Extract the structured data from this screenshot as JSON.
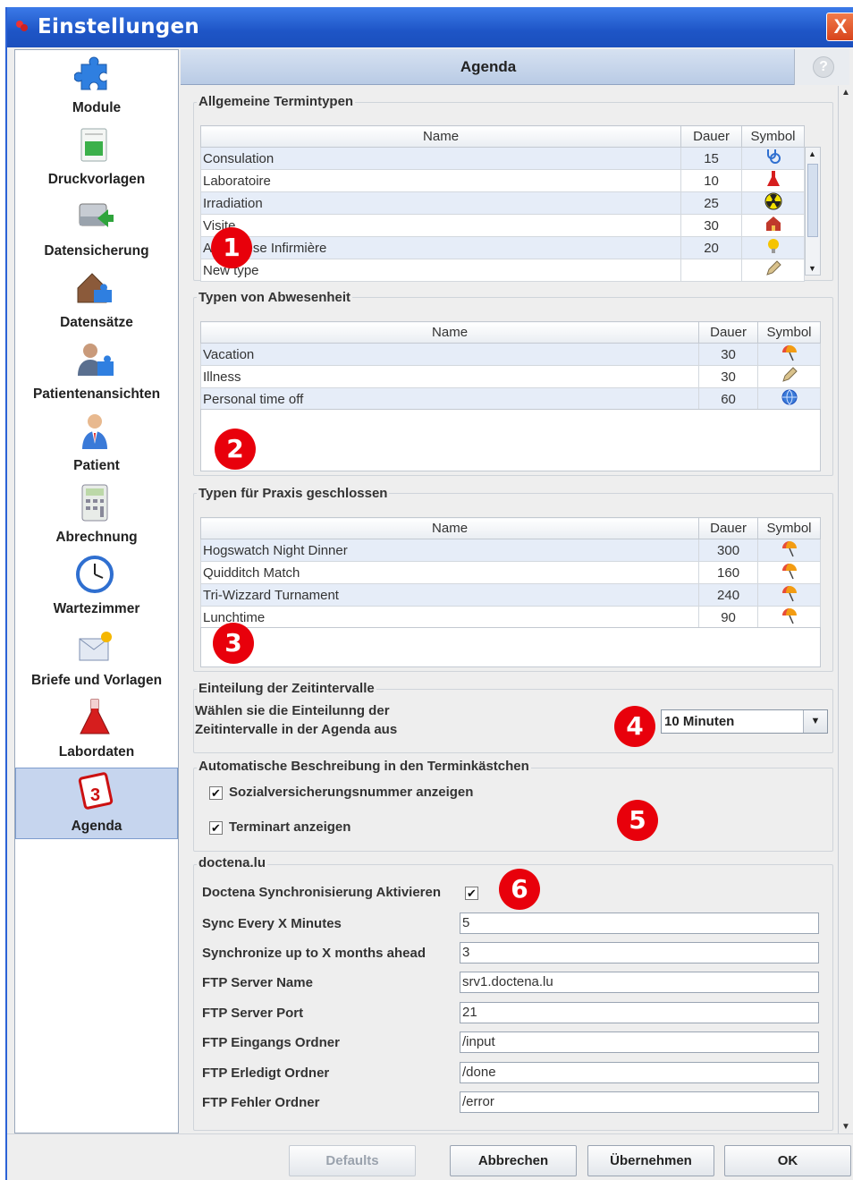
{
  "window": {
    "title": "Einstellungen",
    "close_label": "X"
  },
  "sidebar": {
    "items": [
      {
        "label": "Module",
        "icon": "puzzle-icon"
      },
      {
        "label": "Druckvorlagen",
        "icon": "print-template-icon"
      },
      {
        "label": "Datensicherung",
        "icon": "backup-icon"
      },
      {
        "label": "Datensätze",
        "icon": "house-puzzle-icon"
      },
      {
        "label": "Patientenansichten",
        "icon": "patient-puzzle-icon"
      },
      {
        "label": "Patient",
        "icon": "doctor-icon"
      },
      {
        "label": "Abrechnung",
        "icon": "calculator-icon"
      },
      {
        "label": "Wartezimmer",
        "icon": "clock-icon"
      },
      {
        "label": "Briefe und Vorlagen",
        "icon": "letter-icon"
      },
      {
        "label": "Labordaten",
        "icon": "flask-icon"
      },
      {
        "label": "Agenda",
        "icon": "calendar-icon",
        "active": true
      }
    ]
  },
  "header": {
    "title": "Agenda",
    "help_label": "?"
  },
  "general_types": {
    "title": "Allgemeine Termintypen",
    "columns": [
      "Name",
      "Dauer",
      "Symbol"
    ],
    "rows": [
      {
        "name": "Consulation",
        "duration": "15",
        "icon": "stethoscope-icon"
      },
      {
        "name": "Laboratoire",
        "duration": "10",
        "icon": "flask-icon"
      },
      {
        "name": "Irradiation",
        "duration": "25",
        "icon": "radiation-icon"
      },
      {
        "name": "Visite",
        "duration": "30",
        "icon": "house-icon"
      },
      {
        "name": "Anamnèse Infirmière",
        "duration": "20",
        "icon": "bulb-icon"
      },
      {
        "name": "New type",
        "duration": "",
        "icon": "pencil-icon"
      }
    ]
  },
  "absence_types": {
    "title": "Typen von Abwesenheit",
    "columns": [
      "Name",
      "Dauer",
      "Symbol"
    ],
    "rows": [
      {
        "name": "Vacation",
        "duration": "30",
        "icon": "beach-umbrella-icon"
      },
      {
        "name": "Illness",
        "duration": "30",
        "icon": "pencil-icon"
      },
      {
        "name": "Personal time off",
        "duration": "60",
        "icon": "globe-icon"
      }
    ]
  },
  "closed_types": {
    "title": "Typen für Praxis geschlossen",
    "columns": [
      "Name",
      "Dauer",
      "Symbol"
    ],
    "rows": [
      {
        "name": "Hogswatch Night Dinner",
        "duration": "300",
        "icon": "beach-umbrella-icon"
      },
      {
        "name": "Quidditch Match",
        "duration": "160",
        "icon": "beach-umbrella-icon"
      },
      {
        "name": "Tri-Wizzard Turnament",
        "duration": "240",
        "icon": "beach-umbrella-icon"
      },
      {
        "name": "Lunchtime",
        "duration": "90",
        "icon": "beach-umbrella-icon"
      }
    ]
  },
  "intervals": {
    "title": "Einteilung der Zeitintervalle",
    "desc_line1": "Wählen sie die Einteilunng der",
    "desc_line2": "Zeitintervalle in der Agenda aus",
    "selected": "10 Minuten"
  },
  "auto_desc": {
    "title": "Automatische Beschreibung in den Terminkästchen",
    "checkbox1": {
      "label": "Sozialversicherungsnummer anzeigen",
      "checked": true
    },
    "checkbox2": {
      "label": "Terminart anzeigen",
      "checked": true
    }
  },
  "doctena": {
    "title": "doctena.lu",
    "sync_label": "Doctena Synchronisierung Aktivieren",
    "sync_checked": true,
    "fields": [
      {
        "label": "Sync Every X Minutes",
        "value": "5"
      },
      {
        "label": "Synchronize up to X months ahead",
        "value": "3"
      },
      {
        "label": "FTP Server Name",
        "value": "srv1.doctena.lu"
      },
      {
        "label": "FTP Server Port",
        "value": "21"
      },
      {
        "label": "FTP Eingangs Ordner",
        "value": "/input"
      },
      {
        "label": "FTP Erledigt Ordner",
        "value": "/done"
      },
      {
        "label": "FTP Fehler Ordner",
        "value": "/error"
      }
    ]
  },
  "badges": [
    "1",
    "2",
    "3",
    "4",
    "5",
    "6"
  ],
  "buttons": {
    "defaults": "Defaults",
    "cancel": "Abbrechen",
    "apply": "Übernehmen",
    "ok": "OK"
  },
  "colors": {
    "titlebar": "#1e55c6",
    "badge": "#e8000b",
    "active_item": "#c6d5ee"
  }
}
